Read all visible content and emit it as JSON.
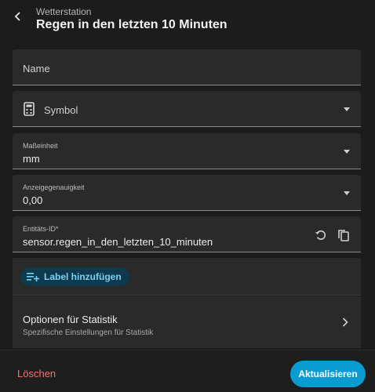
{
  "header": {
    "subtitle": "Wetterstation",
    "title": "Regen in den letzten 10 Minuten"
  },
  "fields": {
    "name": {
      "label": "Name"
    },
    "symbol": {
      "label": "Symbol"
    },
    "unit": {
      "label": "Maßeinheit",
      "value": "mm"
    },
    "precision": {
      "label": "Anzeigegenauigkeit",
      "value": "0,00"
    },
    "entity_id": {
      "label": "Entitäts-ID*",
      "value": "sensor.regen_in_den_letzten_10_minuten"
    }
  },
  "label_button": "Label hinzufügen",
  "statistics": {
    "title": "Optionen für Statistik",
    "subtitle": "Spezifische Einstellungen für Statistik"
  },
  "footer": {
    "delete": "Löschen",
    "update": "Aktualisieren"
  },
  "colors": {
    "background": "#1c1c1c",
    "field": "#2a2a2a",
    "accent": "#0a9bd1",
    "danger": "#ff6e6e"
  }
}
